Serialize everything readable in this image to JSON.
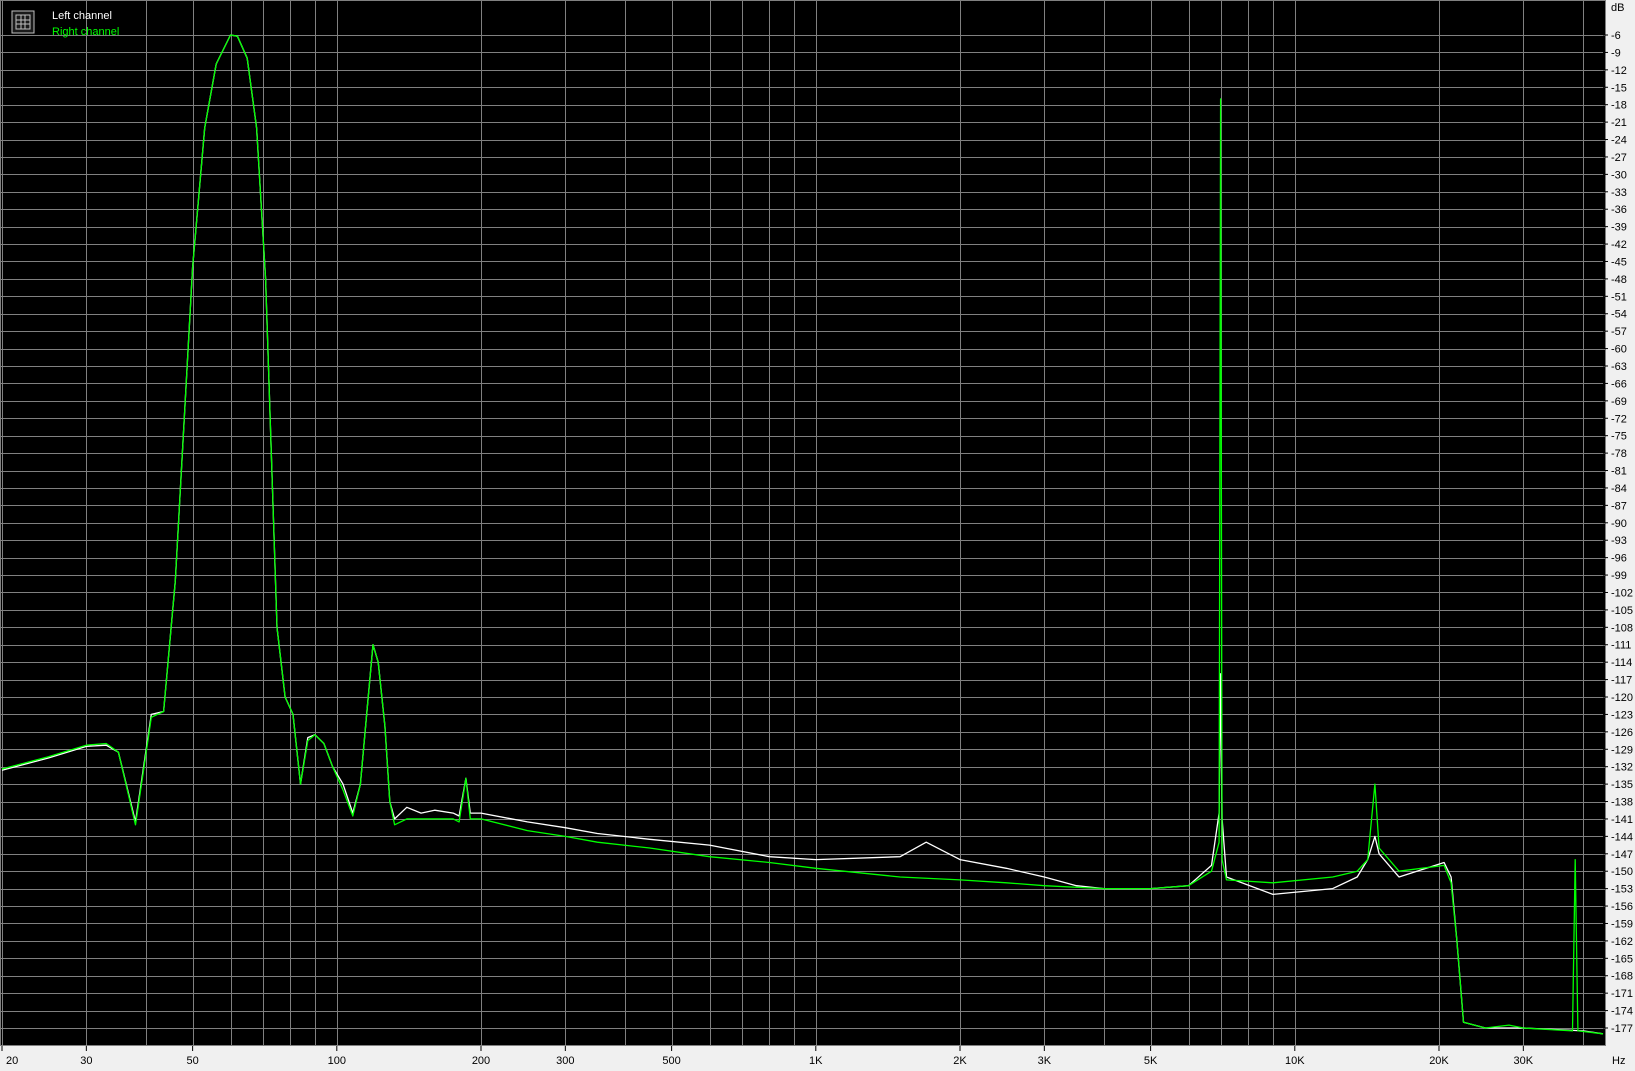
{
  "chart_data": {
    "type": "line",
    "title": "",
    "xlabel": "Hz",
    "ylabel": "dB",
    "x_scale": "log",
    "xlim": [
      20,
      44000
    ],
    "ylim": [
      -179,
      -3
    ],
    "grid": true,
    "background": "#000000",
    "grid_color": "#808080",
    "legend_position": "top-left",
    "x_ticks": [
      {
        "v": 20,
        "label": "20"
      },
      {
        "v": 30,
        "label": "30"
      },
      {
        "v": 50,
        "label": "50"
      },
      {
        "v": 100,
        "label": "100"
      },
      {
        "v": 200,
        "label": "200"
      },
      {
        "v": 300,
        "label": "300"
      },
      {
        "v": 500,
        "label": "500"
      },
      {
        "v": 1000,
        "label": "1K"
      },
      {
        "v": 2000,
        "label": "2K"
      },
      {
        "v": 3000,
        "label": "3K"
      },
      {
        "v": 5000,
        "label": "5K"
      },
      {
        "v": 10000,
        "label": "10K"
      },
      {
        "v": 20000,
        "label": "20K"
      },
      {
        "v": 30000,
        "label": "30K"
      }
    ],
    "x_unit_label": "Hz",
    "y_unit_label": "dB",
    "y_ticks": [
      -6,
      -9,
      -12,
      -15,
      -18,
      -21,
      -24,
      -27,
      -30,
      -33,
      -36,
      -39,
      -42,
      -45,
      -48,
      -51,
      -54,
      -57,
      -60,
      -63,
      -66,
      -69,
      -72,
      -75,
      -78,
      -81,
      -84,
      -87,
      -90,
      -93,
      -96,
      -99,
      -102,
      -105,
      -108,
      -111,
      -114,
      -117,
      -120,
      -123,
      -126,
      -129,
      -132,
      -135,
      -138,
      -141,
      -144,
      -147,
      -150,
      -153,
      -156,
      -159,
      -162,
      -165,
      -168,
      -171,
      -174,
      -177
    ],
    "series": [
      {
        "name": "Left channel",
        "color": "#ffffff",
        "points": [
          [
            20,
            -132.6
          ],
          [
            25,
            -130.5
          ],
          [
            30,
            -128.5
          ],
          [
            33,
            -128.3
          ],
          [
            35,
            -129.5
          ],
          [
            38,
            -141.5
          ],
          [
            41,
            -123
          ],
          [
            43.5,
            -122.5
          ],
          [
            46,
            -100
          ],
          [
            50,
            -46
          ],
          [
            53,
            -22
          ],
          [
            56,
            -11
          ],
          [
            60,
            -6
          ],
          [
            62,
            -6.2
          ],
          [
            65,
            -10
          ],
          [
            68,
            -22
          ],
          [
            71,
            -48
          ],
          [
            75,
            -108
          ],
          [
            78,
            -120
          ],
          [
            81,
            -123
          ],
          [
            84,
            -135
          ],
          [
            87,
            -127
          ],
          [
            90,
            -126.5
          ],
          [
            94,
            -128
          ],
          [
            98,
            -132
          ],
          [
            103,
            -135
          ],
          [
            108,
            -140
          ],
          [
            112,
            -135
          ],
          [
            116,
            -121
          ],
          [
            119,
            -111
          ],
          [
            122,
            -114
          ],
          [
            126,
            -125
          ],
          [
            129,
            -138
          ],
          [
            132,
            -141
          ],
          [
            140,
            -139
          ],
          [
            150,
            -140
          ],
          [
            160,
            -139.5
          ],
          [
            175,
            -140
          ],
          [
            180,
            -140.5
          ],
          [
            186,
            -134
          ],
          [
            190,
            -140
          ],
          [
            200,
            -140
          ],
          [
            250,
            -141.5
          ],
          [
            300,
            -142.5
          ],
          [
            350,
            -143.5
          ],
          [
            450,
            -144.5
          ],
          [
            600,
            -145.5
          ],
          [
            800,
            -147.5
          ],
          [
            1000,
            -148
          ],
          [
            1500,
            -147.5
          ],
          [
            1700,
            -145
          ],
          [
            2000,
            -148
          ],
          [
            2500,
            -149.5
          ],
          [
            3000,
            -151
          ],
          [
            3500,
            -152.5
          ],
          [
            4000,
            -153
          ],
          [
            5000,
            -153
          ],
          [
            6000,
            -152.5
          ],
          [
            6700,
            -149
          ],
          [
            6950,
            -140
          ],
          [
            7000,
            -116
          ],
          [
            7050,
            -141
          ],
          [
            7200,
            -151
          ],
          [
            9000,
            -154
          ],
          [
            12000,
            -153
          ],
          [
            13500,
            -151
          ],
          [
            14200,
            -148
          ],
          [
            14700,
            -144
          ],
          [
            15000,
            -147
          ],
          [
            16500,
            -151
          ],
          [
            20500,
            -148.5
          ],
          [
            21200,
            -151
          ],
          [
            21800,
            -162
          ],
          [
            22500,
            -176
          ],
          [
            25000,
            -177
          ],
          [
            30000,
            -177
          ],
          [
            40000,
            -177.5
          ],
          [
            44000,
            -178
          ]
        ]
      },
      {
        "name": "Right channel",
        "color": "#00ff00",
        "points": [
          [
            20,
            -132.4
          ],
          [
            25,
            -130.3
          ],
          [
            30,
            -128.3
          ],
          [
            33,
            -128
          ],
          [
            35,
            -129.5
          ],
          [
            38,
            -142
          ],
          [
            41,
            -123.5
          ],
          [
            43.5,
            -122.5
          ],
          [
            46,
            -100
          ],
          [
            50,
            -46
          ],
          [
            53,
            -22
          ],
          [
            56,
            -11
          ],
          [
            60,
            -6
          ],
          [
            62,
            -6.2
          ],
          [
            65,
            -10
          ],
          [
            68,
            -22
          ],
          [
            71,
            -48
          ],
          [
            75,
            -108
          ],
          [
            78,
            -120
          ],
          [
            81,
            -123
          ],
          [
            84,
            -135
          ],
          [
            87,
            -127.5
          ],
          [
            90,
            -126.5
          ],
          [
            94,
            -128
          ],
          [
            98,
            -132
          ],
          [
            103,
            -136
          ],
          [
            108,
            -140.5
          ],
          [
            112,
            -135
          ],
          [
            116,
            -121
          ],
          [
            119,
            -111
          ],
          [
            122,
            -114
          ],
          [
            126,
            -125
          ],
          [
            129,
            -138
          ],
          [
            132,
            -142
          ],
          [
            140,
            -141
          ],
          [
            150,
            -141
          ],
          [
            160,
            -141
          ],
          [
            175,
            -141
          ],
          [
            180,
            -141.5
          ],
          [
            186,
            -134
          ],
          [
            190,
            -141
          ],
          [
            200,
            -141
          ],
          [
            250,
            -143
          ],
          [
            300,
            -144
          ],
          [
            350,
            -145
          ],
          [
            450,
            -146
          ],
          [
            600,
            -147.5
          ],
          [
            800,
            -148.5
          ],
          [
            1000,
            -149.5
          ],
          [
            1500,
            -151
          ],
          [
            2000,
            -151.5
          ],
          [
            2500,
            -152
          ],
          [
            3000,
            -152.5
          ],
          [
            4000,
            -153
          ],
          [
            5000,
            -153
          ],
          [
            6000,
            -152.5
          ],
          [
            6700,
            -150
          ],
          [
            6950,
            -145
          ],
          [
            7000,
            -17
          ],
          [
            7050,
            -148
          ],
          [
            7200,
            -151.5
          ],
          [
            9000,
            -152
          ],
          [
            12000,
            -151
          ],
          [
            13500,
            -150
          ],
          [
            14200,
            -148
          ],
          [
            14700,
            -135
          ],
          [
            15000,
            -146
          ],
          [
            16500,
            -150
          ],
          [
            20500,
            -149
          ],
          [
            21200,
            -152
          ],
          [
            21800,
            -162
          ],
          [
            22500,
            -176
          ],
          [
            25000,
            -177
          ],
          [
            28000,
            -176.5
          ],
          [
            30000,
            -177
          ],
          [
            38000,
            -177.5
          ],
          [
            38500,
            -148
          ],
          [
            39000,
            -177.5
          ],
          [
            44000,
            -178
          ]
        ]
      }
    ]
  }
}
